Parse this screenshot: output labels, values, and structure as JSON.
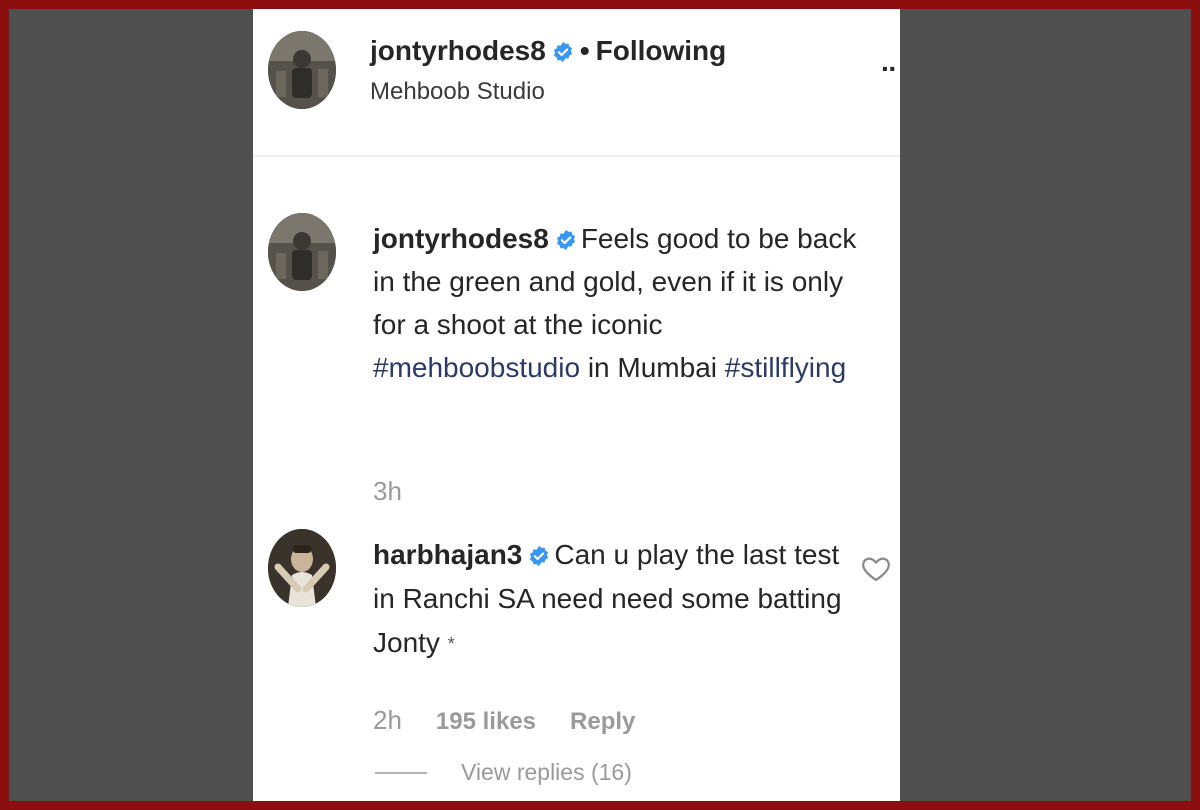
{
  "post_header": {
    "username": "jontyrhodes8",
    "separator": "•",
    "follow_status": "Following",
    "location": "Mehboob Studio",
    "more_glyph": "··"
  },
  "caption": {
    "username": "jontyrhodes8",
    "text_before": "Feels good to be back in the green and gold, even if it is only for a shoot at the iconic",
    "hashtag1": "#mehboobstudio",
    "text_middle": "in Mumbai",
    "hashtag2": "#stillflying",
    "time": "3h"
  },
  "comment": {
    "username": "harbhajan3",
    "text": "Can u play the last test in Ranchi SA need need some batting Jonty",
    "emoji": "*",
    "time": "2h",
    "likes": "195 likes",
    "reply_label": "Reply",
    "view_replies": "View replies (16)"
  },
  "icons": {
    "verified": "verified-badge-icon",
    "heart": "heart-outline-icon",
    "more": "more-options-icon"
  },
  "colors": {
    "frame_border": "#8b0f0f",
    "side_background": "#4f4f4f",
    "verified_blue": "#3897f0",
    "hashtag": "#2b3a66",
    "muted_text": "#9a9a9a"
  }
}
